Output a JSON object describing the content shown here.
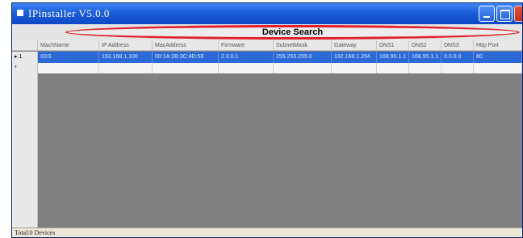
{
  "window": {
    "title": "IPinstaller V5.0.0"
  },
  "toolbar": {
    "search_label": "Device Search"
  },
  "table": {
    "columns": [
      "MachName",
      "IP Address",
      "MacAddress",
      "Firmware",
      "SubnetMask",
      "Gateway",
      "DNS1",
      "DNS2",
      "DNS3",
      "Http Port"
    ],
    "rows": [
      {
        "marker": "▸ 1",
        "cells": [
          "IDIS",
          "192.168.1.100",
          "00:1A:2B:3C:4D:5E",
          "2.0.0.1",
          "255.255.255.0",
          "192.168.1.254",
          "168.95.1.1",
          "168.95.1.1",
          "0.0.0.0",
          "80"
        ]
      }
    ],
    "new_row_marker": "*"
  },
  "status": {
    "text": "Total:0 Devices"
  }
}
